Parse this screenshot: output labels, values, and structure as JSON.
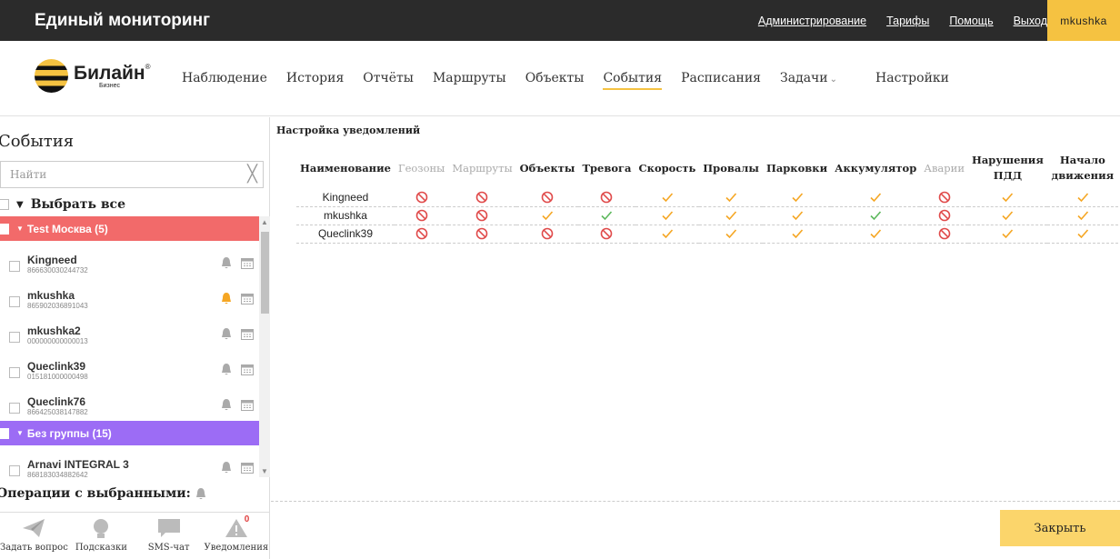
{
  "topbar": {
    "title": "Единый мониторинг",
    "links": [
      "Администрирование",
      "Тарифы",
      "Помощь",
      "Выход"
    ],
    "user": "mkushka"
  },
  "logo": {
    "brand": "Билайн",
    "sub": "Бизнес"
  },
  "nav": {
    "items": [
      "Наблюдение",
      "История",
      "Отчёты",
      "Маршруты",
      "Объекты",
      "События",
      "Расписания",
      "Задачи",
      "Настройки"
    ],
    "active": "События"
  },
  "sidebar": {
    "title": "События",
    "search_placeholder": "Найти",
    "select_all": "Выбрать все",
    "groups": [
      {
        "label": "Test Москва (5)",
        "color": "#f26a6a"
      },
      {
        "label": "Без группы (15)",
        "color": "#9c6cf5"
      }
    ],
    "items": [
      {
        "name": "Kingneed",
        "id": "866630030244732",
        "bell": "#aaaaaa"
      },
      {
        "name": "mkushka",
        "id": "865902036891043",
        "bell": "#f5a623"
      },
      {
        "name": "mkushka2",
        "id": "000000000000013",
        "bell": "#aaaaaa"
      },
      {
        "name": "Queclink39",
        "id": "015181000000498",
        "bell": "#aaaaaa"
      },
      {
        "name": "Queclink76",
        "id": "866425038147882",
        "bell": "#aaaaaa"
      },
      {
        "name": "Arnavi INTEGRAL 3",
        "id": "868183034882642",
        "bell": "#aaaaaa"
      }
    ],
    "ops_label": "Операции с выбранными:",
    "bottom": [
      {
        "label": "Задать вопрос",
        "icon": "paper-plane-icon"
      },
      {
        "label": "Подсказки",
        "icon": "lightbulb-icon"
      },
      {
        "label": "SMS-чат",
        "icon": "chat-icon"
      },
      {
        "label": "Уведомления",
        "icon": "warning-icon",
        "badge": "0"
      }
    ]
  },
  "main": {
    "title": "Настройка уведомлений",
    "columns": [
      "Наименование",
      "Геозоны",
      "Маршруты",
      "Объекты",
      "Тревога",
      "Скорость",
      "Провалы",
      "Парковки",
      "Аккумулятор",
      "Аварии",
      "Нарушения ПДД",
      "Начало движения"
    ],
    "disabled_columns": [
      1,
      2,
      9
    ],
    "rows": [
      {
        "name": "Kingneed",
        "cells": [
          "off",
          "off",
          "off",
          "off",
          "on",
          "on",
          "on",
          "on",
          "off",
          "on",
          "on"
        ]
      },
      {
        "name": "mkushka",
        "cells": [
          "off",
          "off",
          "on",
          "green",
          "on",
          "on",
          "on",
          "green",
          "off",
          "on",
          "on"
        ]
      },
      {
        "name": "Queclink39",
        "cells": [
          "off",
          "off",
          "off",
          "off",
          "on",
          "on",
          "on",
          "on",
          "off",
          "on",
          "on"
        ]
      }
    ],
    "close_label": "Закрыть"
  },
  "colors": {
    "accent": "#f5c241",
    "check_orange": "#f5a623",
    "check_green": "#5cb85c",
    "forbidden": "#e04b4b"
  }
}
